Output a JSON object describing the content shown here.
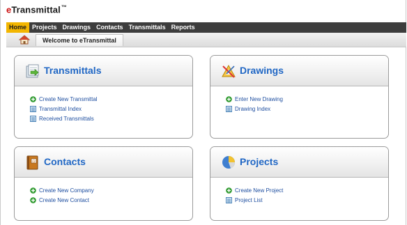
{
  "app": {
    "brand_e": "e",
    "brand_rest": "Transmittal",
    "brand_tm": "™"
  },
  "nav": {
    "items": [
      {
        "label": "Home",
        "active": true
      },
      {
        "label": "Projects"
      },
      {
        "label": "Drawings"
      },
      {
        "label": "Contacts"
      },
      {
        "label": "Transmittals"
      },
      {
        "label": "Reports"
      }
    ]
  },
  "breadcrumb": {
    "tab": "Welcome to eTransmittal"
  },
  "panels": {
    "transmittals": {
      "title": "Transmittals",
      "links": [
        "Create New Transmittal",
        "Transmittal Index",
        "Received Transmittals"
      ]
    },
    "drawings": {
      "title": "Drawings",
      "links": [
        "Enter New Drawing",
        "Drawing Index"
      ]
    },
    "contacts": {
      "title": "Contacts",
      "links": [
        "Create New Company",
        "Create New Contact"
      ]
    },
    "projects": {
      "title": "Projects",
      "links": [
        "Create New Project",
        "Project List"
      ]
    }
  },
  "colors": {
    "nav_bg": "#3d3d3d",
    "nav_active": "#f3b600",
    "panel_title": "#1f66c4",
    "link": "#1f4fa0",
    "add_icon": "#2f9a2f"
  }
}
